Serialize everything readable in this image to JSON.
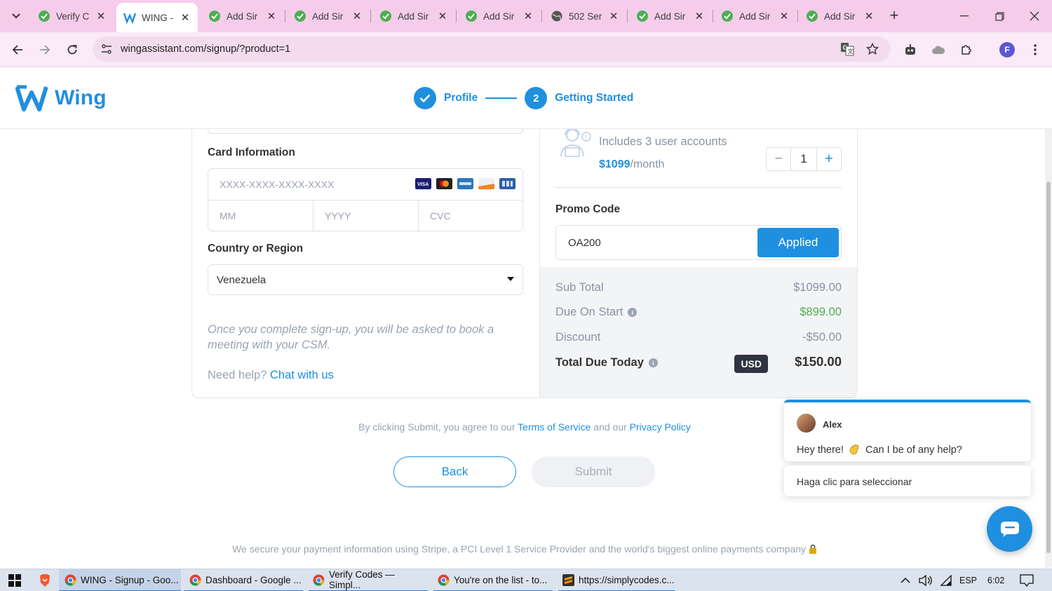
{
  "browser": {
    "tabs": [
      {
        "title": "Verify C",
        "icon": "check-leaf-icon",
        "active": false
      },
      {
        "title": "WING -",
        "icon": "wing-logo-icon",
        "active": true
      },
      {
        "title": "Add Sir",
        "icon": "check-leaf-icon",
        "active": false
      },
      {
        "title": "Add Sir",
        "icon": "check-leaf-icon",
        "active": false
      },
      {
        "title": "Add Sir",
        "icon": "check-leaf-icon",
        "active": false
      },
      {
        "title": "Add Sir",
        "icon": "check-leaf-icon",
        "active": false
      },
      {
        "title": "502 Ser",
        "icon": "globe-icon",
        "active": false
      },
      {
        "title": "Add Sir",
        "icon": "check-leaf-icon",
        "active": false
      },
      {
        "title": "Add Sir",
        "icon": "check-leaf-icon",
        "active": false
      },
      {
        "title": "Add Sir",
        "icon": "check-leaf-icon",
        "active": false
      }
    ],
    "new_tab": "+",
    "url": "wingassistant.com/signup/?product=1",
    "profile_initial": "F"
  },
  "header": {
    "logo_text": "Wing",
    "steps": [
      {
        "label": "Profile",
        "state": "done"
      },
      {
        "number": "2",
        "label": "Getting Started",
        "state": "current"
      }
    ]
  },
  "form": {
    "card_label": "Card Information",
    "card_placeholder": "XXXX-XXXX-XXXX-XXXX",
    "mm_placeholder": "MM",
    "yyyy_placeholder": "YYYY",
    "cvc_placeholder": "CVC",
    "card_brands": [
      "visa",
      "mastercard",
      "amex",
      "discover",
      "jcb"
    ],
    "country_label": "Country or Region",
    "country_value": "Venezuela",
    "note": "Once you complete sign-up, you will be asked to book a meeting with your CSM.",
    "help_text": "Need help?",
    "help_link": "Chat with us"
  },
  "plan": {
    "includes": "Includes 3 user accounts",
    "price": "$1099",
    "period": "/month",
    "minus": "−",
    "quantity": "1",
    "plus": "+",
    "promo_label": "Promo Code",
    "promo_value": "OA200",
    "applied_label": "Applied"
  },
  "summary": {
    "subtotal_label": "Sub Total",
    "subtotal_value": "$1099.00",
    "due_label": "Due On Start",
    "due_value": "$899.00",
    "discount_label": "Discount",
    "discount_value": "-$50.00",
    "total_label": "Total Due Today",
    "currency": "USD",
    "total_value": "$150.00",
    "info_glyph": "i"
  },
  "footer": {
    "terms_prefix": "By clicking Submit, you agree to our",
    "terms_link": "Terms of Service",
    "terms_and": "and our",
    "privacy_link": "Privacy Policy",
    "back_label": "Back",
    "submit_label": "Submit",
    "secure_text": "We secure your payment information using Stripe, a PCI Level 1 Service Provider and the world's biggest online payments company"
  },
  "chat": {
    "agent_name": "Alex",
    "message_start": "Hey there!",
    "message_end": "Can I be of any help?",
    "option": "Haga clic para seleccionar"
  },
  "taskbar": {
    "items": [
      {
        "label": "WING - Signup - Goo...",
        "icon": "chrome-icon",
        "state": "active"
      },
      {
        "label": "Dashboard - Google ...",
        "icon": "chrome-icon",
        "state": "open"
      },
      {
        "label": "Verify Codes — Simpl...",
        "icon": "chrome-icon",
        "state": "open"
      },
      {
        "label": "You're on the list - to...",
        "icon": "chrome-icon",
        "state": "open"
      },
      {
        "label": "https://simplycodes.c...",
        "icon": "sublime-icon",
        "state": "open"
      }
    ],
    "language": "ESP",
    "time": "6:02"
  },
  "colors": {
    "accent": "#1f8fe0",
    "green": "#4caf50",
    "tabbar": "#f5cdeb"
  }
}
